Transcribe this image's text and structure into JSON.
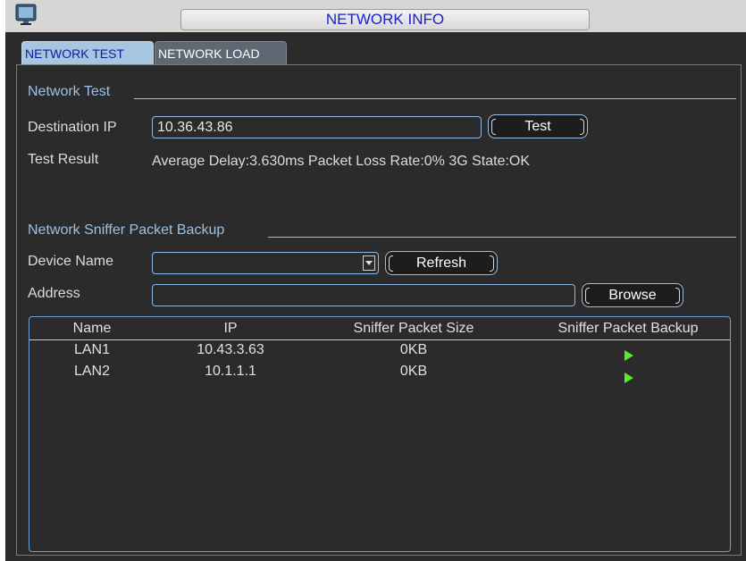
{
  "window": {
    "title": "NETWORK INFO",
    "icon": "monitor-icon"
  },
  "tabs": [
    {
      "label": "NETWORK TEST",
      "active": true
    },
    {
      "label": "NETWORK LOAD",
      "active": false
    }
  ],
  "network_test": {
    "section_title": "Network Test",
    "destination_ip_label": "Destination IP",
    "destination_ip_value": "10.36.43.86",
    "test_button": "Test",
    "test_result_label": "Test Result",
    "test_result_value": "Average Delay:3.630ms  Packet Loss Rate:0%  3G State:OK"
  },
  "sniffer": {
    "section_title": "Network Sniffer Packet Backup",
    "device_name_label": "Device Name",
    "device_name_value": "",
    "refresh_button": "Refresh",
    "address_label": "Address",
    "address_value": "",
    "browse_button": "Browse",
    "columns": [
      "Name",
      "IP",
      "Sniffer Packet Size",
      "Sniffer Packet Backup"
    ],
    "rows": [
      {
        "name": "LAN1",
        "ip": "10.43.3.63",
        "size": "0KB",
        "backup_icon": "play-icon"
      },
      {
        "name": "LAN2",
        "ip": "10.1.1.1",
        "size": "0KB",
        "backup_icon": "play-icon"
      }
    ]
  },
  "colors": {
    "accent_blue": "#9ec0e4",
    "title_text": "#1a22c8",
    "play_green": "#55ee22",
    "background": "#2b2b2b"
  }
}
